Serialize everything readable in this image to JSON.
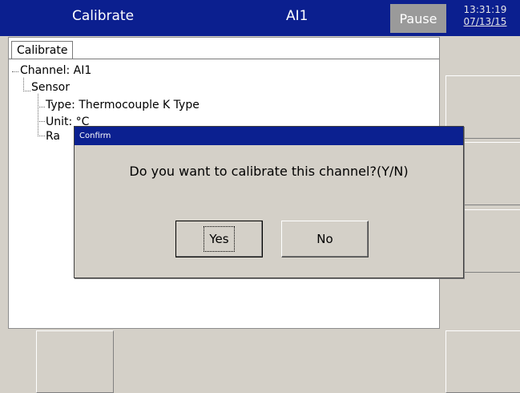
{
  "header": {
    "title": "Calibrate",
    "channel": "AI1",
    "pause_label": "Pause",
    "time": "13:31:19",
    "date": "07/13/15"
  },
  "panel": {
    "tab_label": "Calibrate",
    "tree": {
      "channel": "Channel: AI1",
      "sensor": "Sensor",
      "type": "Type: Thermocouple K Type",
      "unit": "Unit: °C",
      "range_partial": "Ra"
    }
  },
  "dialog": {
    "title": "Confirm",
    "message": "Do you want to calibrate this channel?(Y/N)",
    "yes_label": "Yes",
    "no_label": "No"
  },
  "colors": {
    "header_bg": "#0b1f8f",
    "pause_bg": "#9a9a9a",
    "dialog_title_bg": "#0b2090",
    "window_bg": "#d4d0c8"
  }
}
